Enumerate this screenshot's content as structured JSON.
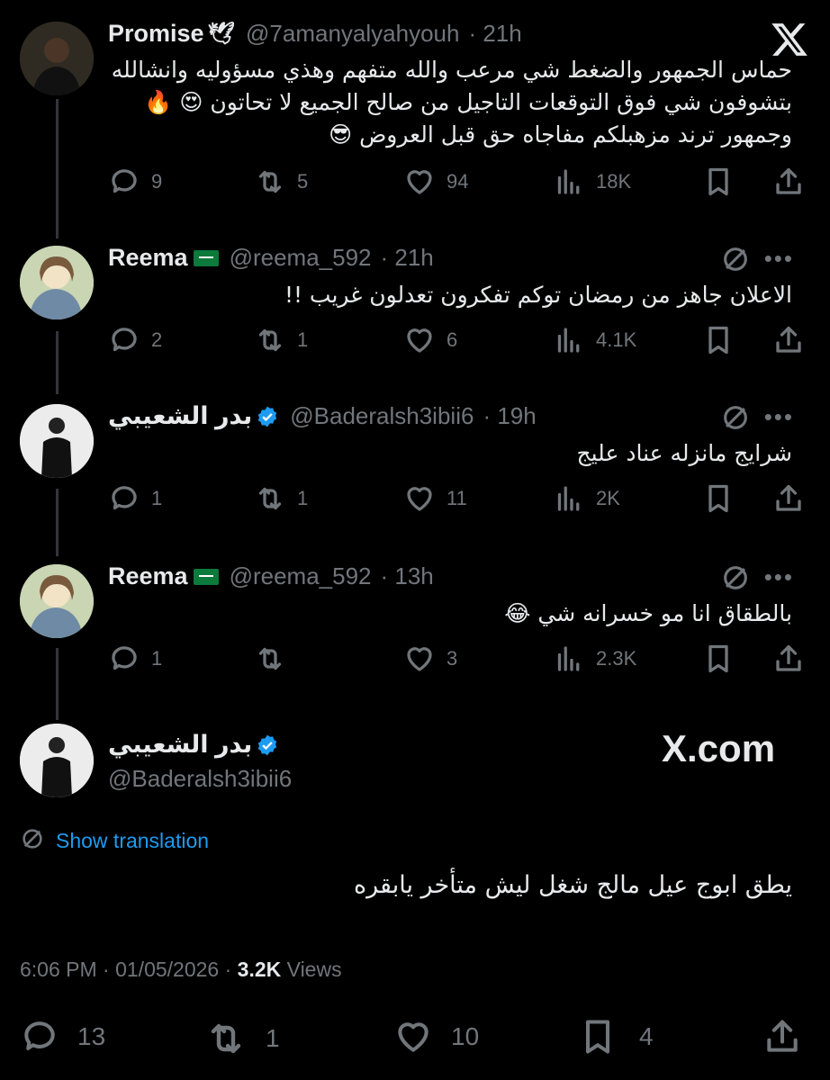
{
  "brand": {
    "x_logo": "X",
    "watermark": "X.com"
  },
  "tweets": [
    {
      "name": "Promise",
      "name_emoji": "🕊",
      "handle": "@7amanyalyahyouh",
      "time": "· 21h",
      "lines": [
        "حماس الجمهور والضغط شي مرعب والله متفهم وهذي مسؤوليه وانشالله",
        "بتشوفون شي فوق التوقعات التاجيل من صالح الجميع لا تحاتون 😍 🔥",
        "وجمهور ترند مزهبلكم مفاجاه حق قبل العروض 😎"
      ],
      "replies": "9",
      "reposts": "5",
      "likes": "94",
      "views": "18K"
    },
    {
      "name": "Reema",
      "handle": "@reema_592",
      "time": "· 21h",
      "lines": [
        "الاعلان جاهز من رمضان توكم تفكرون تعدلون غريب !!"
      ],
      "replies": "2",
      "reposts": "1",
      "likes": "6",
      "views": "4.1K"
    },
    {
      "name": "بدر الشعيبي",
      "handle": "@Baderalsh3ibii6",
      "time": "· 19h",
      "lines": [
        "شرايج مانزله عناد عليج"
      ],
      "replies": "1",
      "reposts": "1",
      "likes": "11",
      "views": "2K"
    },
    {
      "name": "Reema",
      "handle": "@reema_592",
      "time": "· 13h",
      "lines": [
        "بالطقاق انا مو خسرانه شي 😂"
      ],
      "replies": "1",
      "reposts": "",
      "likes": "3",
      "views": "2.3K"
    }
  ],
  "main_tweet": {
    "name": "بدر الشعيبي",
    "handle": "@Baderalsh3ibii6",
    "show_translation": "Show translation",
    "text": "يطق ابوج عيل مالج شغل ليش متأخر يابقره",
    "time": "6:06 PM · 01/05/2026 ·",
    "views_count": "3.2K",
    "views_label": "Views",
    "replies": "13",
    "reposts": "1",
    "likes": "10",
    "bookmarks": "4"
  },
  "colors": {
    "background": "#000000",
    "text": "#e7e9ea",
    "muted": "#71767b",
    "link": "#1d9bf0",
    "verified": "#1d9bf0"
  }
}
